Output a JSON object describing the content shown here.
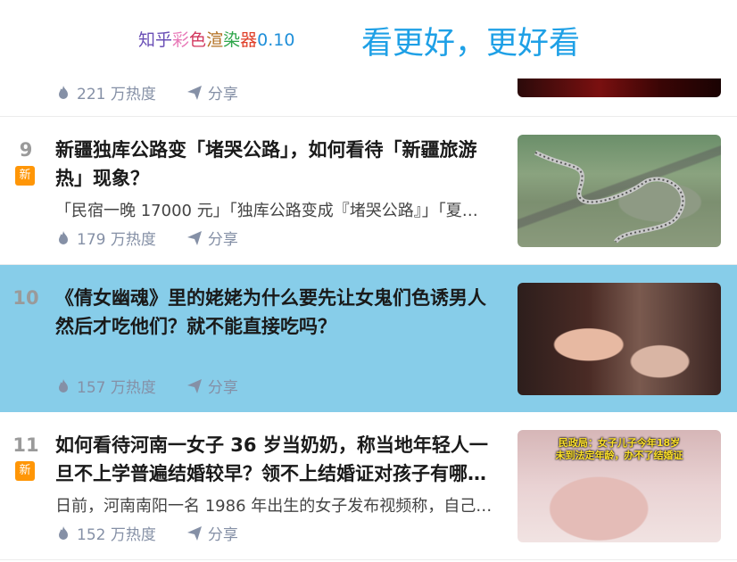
{
  "header": {
    "app_title_chars": [
      {
        "ch": "知",
        "color": "#6a4fb6"
      },
      {
        "ch": "乎",
        "color": "#6a4fb6"
      },
      {
        "ch": "彩",
        "color": "#e87ab8"
      },
      {
        "ch": "色",
        "color": "#d2365c"
      },
      {
        "ch": "渲",
        "color": "#b26e1e"
      },
      {
        "ch": "染",
        "color": "#2ea64a"
      },
      {
        "ch": "器",
        "color": "#e0402a"
      },
      {
        "ch": "0.10",
        "color": "#1f8fd9"
      }
    ],
    "slogan": "看更好，更好看"
  },
  "partial_item": {
    "heat": "221 万热度",
    "share": "分享"
  },
  "items": [
    {
      "rank": "9",
      "badge": "新",
      "title": "新疆独库公路变「堵哭公路」，如何看待「新疆旅游热」现象？",
      "excerpt": "「民宿一晚 17000 元」「独库公路变成『堵哭公路』」「夏…",
      "heat": "179 万热度",
      "share": "分享",
      "thumb_caption": ""
    },
    {
      "rank": "10",
      "badge": "",
      "title": "《倩女幽魂》里的姥姥为什么要先让女鬼们色诱男人然后才吃他们？就不能直接吃吗？",
      "excerpt": "",
      "heat": "157 万热度",
      "share": "分享",
      "thumb_caption": ""
    },
    {
      "rank": "11",
      "badge": "新",
      "title": "如何看待河南一女子 36 岁当奶奶，称当地年轻人一旦不上学普遍结婚较早？领不上结婚证对孩子有哪…",
      "excerpt": "日前，河南南阳一名 1986 年出生的女子发布视频称，自己…",
      "heat": "152 万热度",
      "share": "分享",
      "thumb_caption_line1": "民政局：女子儿子今年18岁",
      "thumb_caption_line2": "未到法定年龄，办不了结婚证"
    }
  ],
  "colors": {
    "highlight_row": "#87cde9",
    "badge": "#ff9607",
    "slogan": "#1ea0e6",
    "meta": "#8590a6"
  }
}
